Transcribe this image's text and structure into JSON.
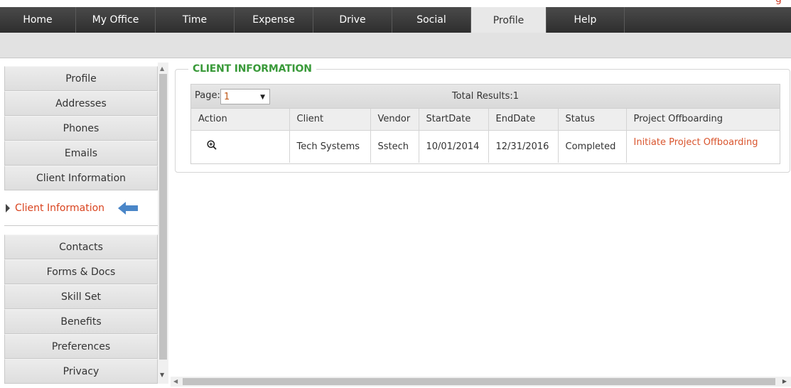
{
  "nav": {
    "tabs": [
      {
        "label": "Home"
      },
      {
        "label": "My Office"
      },
      {
        "label": "Time"
      },
      {
        "label": "Expense"
      },
      {
        "label": "Drive"
      },
      {
        "label": "Social"
      },
      {
        "label": "Profile"
      },
      {
        "label": "Help"
      }
    ],
    "active_tab": "Profile"
  },
  "sidebar": {
    "items_before": [
      {
        "label": "Profile"
      },
      {
        "label": "Addresses"
      },
      {
        "label": "Phones"
      },
      {
        "label": "Emails"
      },
      {
        "label": "Client Information"
      }
    ],
    "active_label": "Client Information",
    "items_after": [
      {
        "label": "Contacts"
      },
      {
        "label": "Forms & Docs"
      },
      {
        "label": "Skill Set"
      },
      {
        "label": "Benefits"
      },
      {
        "label": "Preferences"
      },
      {
        "label": "Privacy"
      }
    ]
  },
  "section": {
    "legend": "CLIENT INFORMATION"
  },
  "grid": {
    "page_label": "Page:",
    "page_value": "1",
    "total_results": "Total Results:1",
    "columns": [
      "Action",
      "Client",
      "Vendor",
      "StartDate",
      "EndDate",
      "Status",
      "Project Offboarding"
    ],
    "rows": [
      {
        "client": "Tech Systems",
        "vendor": "Sstech",
        "start_date": "10/01/2014",
        "end_date": "12/31/2016",
        "status": "Completed",
        "offboarding_link": "Initiate Project Offboarding"
      }
    ]
  },
  "colors": {
    "nav_bg": "#3a3a3a",
    "legend_green": "#3a9a3a",
    "active_orange": "#d9431e",
    "link_orange": "#d9552e",
    "arrow_blue": "#4a86c8"
  },
  "icons": {
    "zoom": "zoom-in-icon",
    "active_pointer": "arrow-left-icon"
  }
}
